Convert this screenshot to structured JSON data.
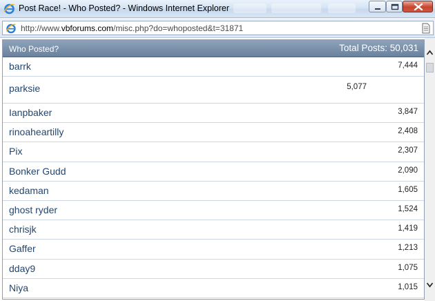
{
  "window": {
    "title": "Post Race! - Who Posted? - Windows Internet Explorer"
  },
  "address": {
    "url_prefix": "http://www.",
    "url_domain": "vbforums.com",
    "url_path": "/misc.php?do=whoposted&t=31871"
  },
  "table": {
    "header_left": "Who Posted?",
    "header_right": "Total Posts: 50,031",
    "rows": [
      {
        "name": "barrk",
        "posts": "7,444"
      },
      {
        "name": "parksie",
        "posts": "5,077"
      },
      {
        "name": "Ianpbaker",
        "posts": "3,847"
      },
      {
        "name": "rinoaheartilly",
        "posts": "2,408"
      },
      {
        "name": "Pix",
        "posts": "2,307"
      },
      {
        "name": "Bonker Gudd",
        "posts": "2,090"
      },
      {
        "name": "kedaman",
        "posts": "1,605"
      },
      {
        "name": "ghost ryder",
        "posts": "1,524"
      },
      {
        "name": "chrisjk",
        "posts": "1,419"
      },
      {
        "name": "Gaffer",
        "posts": "1,213"
      },
      {
        "name": "dday9",
        "posts": "1,075"
      },
      {
        "name": "Niya",
        "posts": "1,015"
      }
    ]
  },
  "colors": {
    "header_bg": "#7c92ad",
    "link": "#23466d"
  },
  "icons": {
    "browser": "internet-explorer-icon",
    "page": "page-icon",
    "minimize": "minimize-icon",
    "maximize": "maximize-icon",
    "close": "close-icon"
  }
}
